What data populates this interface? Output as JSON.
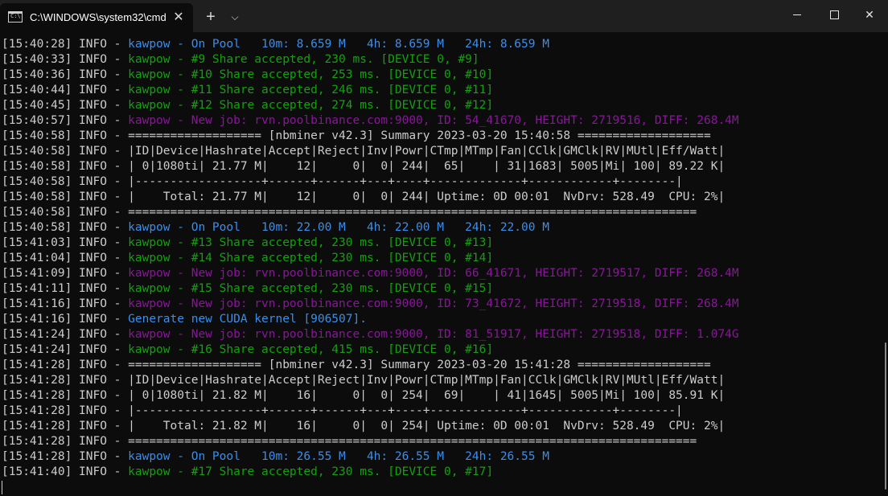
{
  "window": {
    "tab_title": "C:\\WINDOWS\\system32\\cmd.",
    "tab_icon_text": "C:\\",
    "close_tab": "✕",
    "new_tab": "+",
    "dropdown": "⌵",
    "close_window": "✕"
  },
  "colors": {
    "plain": "#cccccc",
    "blue": "#3b8eea",
    "green": "#13a10e",
    "magenta": "#881798"
  },
  "lines": [
    {
      "prefix": "[15:40:28] INFO - ",
      "text": "kawpow - On Pool   10m: 8.659 M   4h: 8.659 M   24h: 8.659 M",
      "color": "blue"
    },
    {
      "prefix": "[15:40:33] INFO - ",
      "text": "kawpow - #9 Share accepted, 230 ms. [DEVICE 0, #9]",
      "color": "green"
    },
    {
      "prefix": "[15:40:36] INFO - ",
      "text": "kawpow - #10 Share accepted, 253 ms. [DEVICE 0, #10]",
      "color": "green"
    },
    {
      "prefix": "[15:40:44] INFO - ",
      "text": "kawpow - #11 Share accepted, 246 ms. [DEVICE 0, #11]",
      "color": "green"
    },
    {
      "prefix": "[15:40:45] INFO - ",
      "text": "kawpow - #12 Share accepted, 274 ms. [DEVICE 0, #12]",
      "color": "green"
    },
    {
      "prefix": "[15:40:57] INFO - ",
      "text": "kawpow - New job: rvn.poolbinance.com:9000, ID: 54_41670, HEIGHT: 2719516, DIFF: 268.4M",
      "color": "magenta"
    },
    {
      "prefix": "[15:40:58] INFO - ",
      "text": "=================== [nbminer v42.3] Summary 2023-03-20 15:40:58 ===================",
      "color": "plain"
    },
    {
      "prefix": "[15:40:58] INFO - ",
      "text": "|ID|Device|Hashrate|Accept|Reject|Inv|Powr|CTmp|MTmp|Fan|CClk|GMClk|RV|MUtl|Eff/Watt|",
      "color": "plain"
    },
    {
      "prefix": "[15:40:58] INFO - ",
      "text": "| 0|1080ti| 21.77 M|    12|     0|  0| 244|  65|    | 31|1683| 5005|Mi| 100| 89.22 K|",
      "color": "plain"
    },
    {
      "prefix": "[15:40:58] INFO - ",
      "text": "|------------------+------+------+---+----+-------------+------------+--------|",
      "color": "plain"
    },
    {
      "prefix": "[15:40:58] INFO - ",
      "text": "|    Total: 21.77 M|    12|     0|  0| 244| Uptime: 0D 00:01  NvDrv: 528.49  CPU: 2%|",
      "color": "plain"
    },
    {
      "prefix": "[15:40:58] INFO - ",
      "text": "=================================================================================",
      "color": "plain"
    },
    {
      "prefix": "[15:40:58] INFO - ",
      "text": "kawpow - On Pool   10m: 22.00 M   4h: 22.00 M   24h: 22.00 M",
      "color": "blue"
    },
    {
      "prefix": "[15:41:03] INFO - ",
      "text": "kawpow - #13 Share accepted, 230 ms. [DEVICE 0, #13]",
      "color": "green"
    },
    {
      "prefix": "[15:41:04] INFO - ",
      "text": "kawpow - #14 Share accepted, 230 ms. [DEVICE 0, #14]",
      "color": "green"
    },
    {
      "prefix": "[15:41:09] INFO - ",
      "text": "kawpow - New job: rvn.poolbinance.com:9000, ID: 66_41671, HEIGHT: 2719517, DIFF: 268.4M",
      "color": "magenta"
    },
    {
      "prefix": "[15:41:11] INFO - ",
      "text": "kawpow - #15 Share accepted, 230 ms. [DEVICE 0, #15]",
      "color": "green"
    },
    {
      "prefix": "[15:41:16] INFO - ",
      "text": "kawpow - New job: rvn.poolbinance.com:9000, ID: 73_41672, HEIGHT: 2719518, DIFF: 268.4M",
      "color": "magenta"
    },
    {
      "prefix": "[15:41:16] INFO - ",
      "text": "Generate new CUDA kernel [906507].",
      "color": "blue"
    },
    {
      "prefix": "[15:41:24] INFO - ",
      "text": "kawpow - New job: rvn.poolbinance.com:9000, ID: 81_51917, HEIGHT: 2719518, DIFF: 1.074G",
      "color": "magenta"
    },
    {
      "prefix": "[15:41:24] INFO - ",
      "text": "kawpow - #16 Share accepted, 415 ms. [DEVICE 0, #16]",
      "color": "green"
    },
    {
      "prefix": "[15:41:28] INFO - ",
      "text": "=================== [nbminer v42.3] Summary 2023-03-20 15:41:28 ===================",
      "color": "plain"
    },
    {
      "prefix": "[15:41:28] INFO - ",
      "text": "|ID|Device|Hashrate|Accept|Reject|Inv|Powr|CTmp|MTmp|Fan|CClk|GMClk|RV|MUtl|Eff/Watt|",
      "color": "plain"
    },
    {
      "prefix": "[15:41:28] INFO - ",
      "text": "| 0|1080ti| 21.82 M|    16|     0|  0| 254|  69|    | 41|1645| 5005|Mi| 100| 85.91 K|",
      "color": "plain"
    },
    {
      "prefix": "[15:41:28] INFO - ",
      "text": "|------------------+------+------+---+----+-------------+------------+--------|",
      "color": "plain"
    },
    {
      "prefix": "[15:41:28] INFO - ",
      "text": "|    Total: 21.82 M|    16|     0|  0| 254| Uptime: 0D 00:01  NvDrv: 528.49  CPU: 2%|",
      "color": "plain"
    },
    {
      "prefix": "[15:41:28] INFO - ",
      "text": "=================================================================================",
      "color": "plain"
    },
    {
      "prefix": "[15:41:28] INFO - ",
      "text": "kawpow - On Pool   10m: 26.55 M   4h: 26.55 M   24h: 26.55 M",
      "color": "blue"
    },
    {
      "prefix": "[15:41:40] INFO - ",
      "text": "kawpow - #17 Share accepted, 230 ms. [DEVICE 0, #17]",
      "color": "green"
    }
  ]
}
